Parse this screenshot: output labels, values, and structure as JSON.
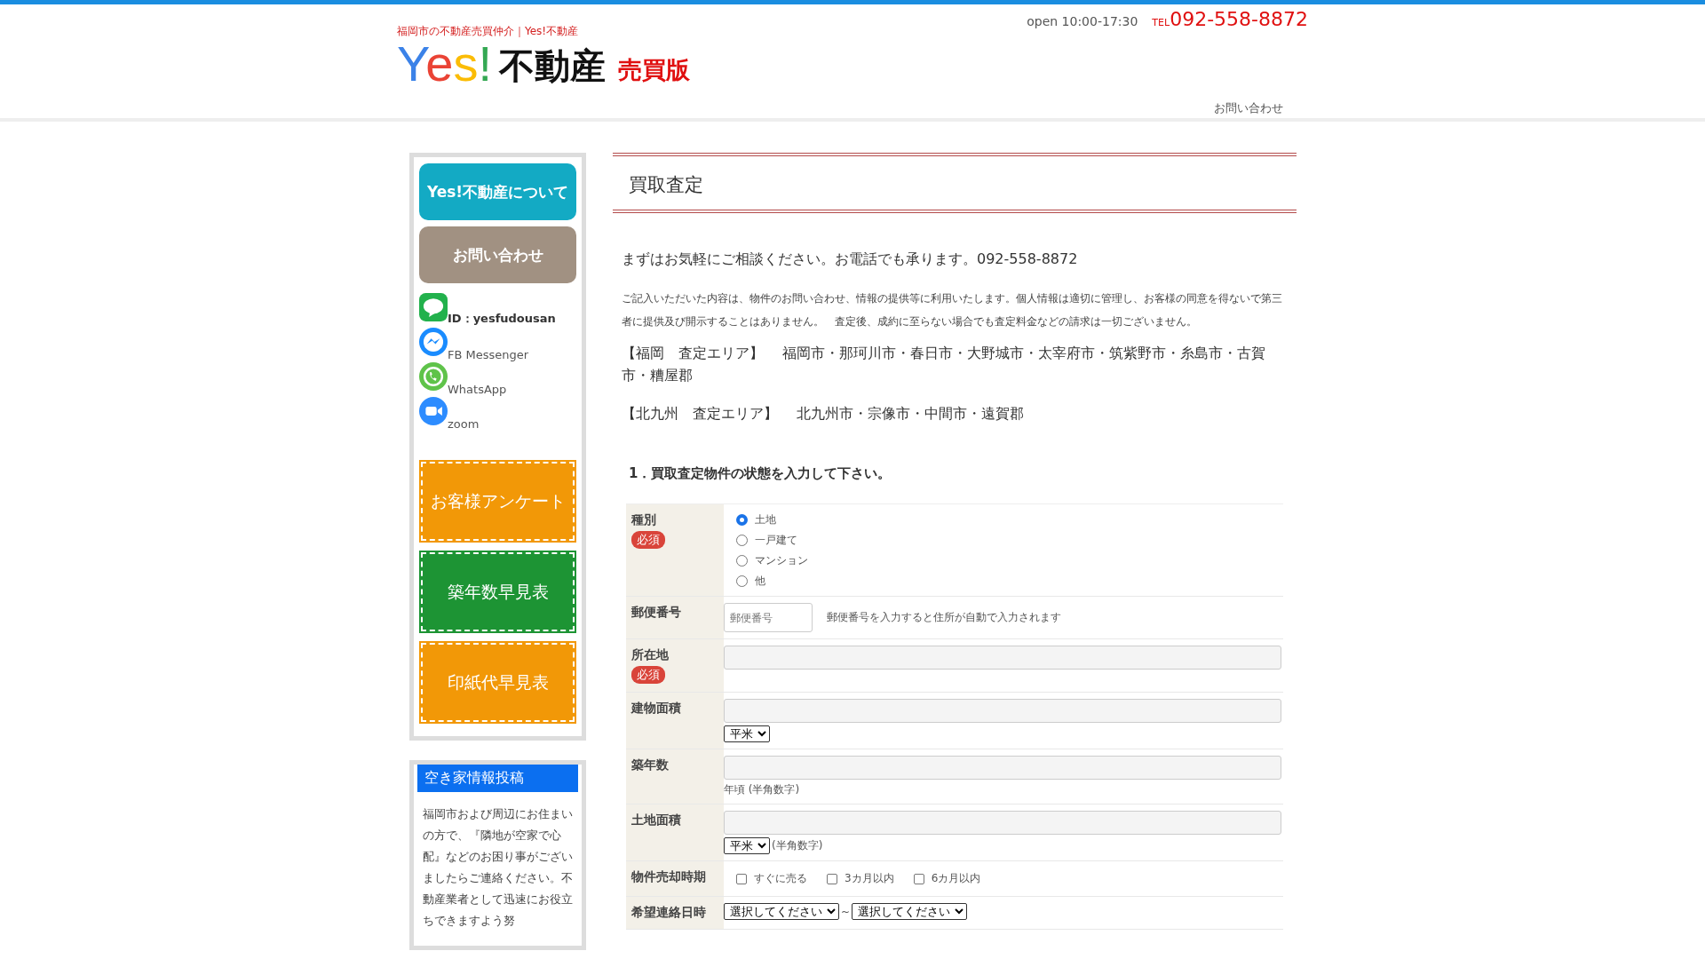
{
  "header": {
    "tagline": "福岡市の不動産売買仲介｜Yes!不動産",
    "logo": {
      "letters": [
        {
          "char": "Y",
          "color": "#3b82e8"
        },
        {
          "char": "e",
          "color": "#ea4335"
        },
        {
          "char": "s",
          "color": "#fbbc05"
        },
        {
          "char": "!",
          "color": "#34a853"
        }
      ],
      "name": "不動産",
      "edition": "売買版"
    },
    "hours": "open 10:00-17:30",
    "tel_prefix": "TEL",
    "tel": "092-558-8872",
    "nav": [
      "お問い合わせ"
    ]
  },
  "sidebar": {
    "banners": [
      {
        "label": "Yes!不動産について",
        "kind": "rounded",
        "color": "#13aac4"
      },
      {
        "label": "お問い合わせ",
        "kind": "rounded",
        "color": "#a19182"
      }
    ],
    "contacts": [
      {
        "kind": "line",
        "label": "ID：yesfudousan"
      },
      {
        "kind": "messenger",
        "label": "FB Messenger"
      },
      {
        "kind": "whatsapp",
        "label": "WhatsApp"
      },
      {
        "kind": "zoom",
        "label": "zoom"
      }
    ],
    "links": [
      {
        "label": "お客様アンケート",
        "kind": "stitched",
        "color": "#f29807"
      },
      {
        "label": "築年数早見表",
        "kind": "stitched",
        "color": "#1d9434"
      },
      {
        "label": "印紙代早見表",
        "kind": "stitched",
        "color": "#f29807"
      }
    ],
    "post_box": {
      "title": "空き家情報投稿",
      "text": "福岡市および周辺にお住まいの方で、『隣地が空家で心配』などのお困り事がございましたらご連絡ください。不動産業者として迅速にお役立ちできますよう努"
    }
  },
  "main": {
    "title": "買取査定",
    "lead": "まずはお気軽にご相談ください。お電話でも承ります。092-558-8872",
    "notice": "ご記入いただいた内容は、物件のお問い合わせ、情報の提供等に利用いたします。個人情報は適切に管理し、お客様の同意を得ないで第三者に提供及び開示することはありません。　査定後、成約に至らない場合でも査定料金などの請求は一切ございません。",
    "areas": [
      "【福岡　査定エリア】　 福岡市・那珂川市・春日市・大野城市・太宰府市・筑紫野市・糸島市・古賀市・糟屋郡",
      "【北九州　査定エリア】　 北九州市・宗像市・中間市・遠賀郡"
    ],
    "section_heading": "1．買取査定物件の状態を入力して下さい。",
    "form": [
      {
        "label": "種別",
        "badge": "必須",
        "kind": "radio",
        "options": [
          {
            "label": "土地",
            "selected": true
          },
          {
            "label": "一戸建て",
            "selected": false
          },
          {
            "label": "マンション",
            "selected": false
          },
          {
            "label": "他",
            "selected": false
          }
        ]
      },
      {
        "label": "郵便番号",
        "kind": "postal",
        "placeholder": "郵便番号",
        "hint": "郵便番号を入力すると住所が自動で入力されます"
      },
      {
        "label": "所在地",
        "badge": "必須",
        "kind": "text"
      },
      {
        "label": "建物面積",
        "kind": "text",
        "unit": "平米"
      },
      {
        "label": "築年数",
        "kind": "text",
        "note": "年頃 (半角数字)"
      },
      {
        "label": "土地面積",
        "kind": "text",
        "unit": "平米",
        "note": "(半角数字)"
      },
      {
        "label": "物件売却時期",
        "kind": "checkbox",
        "options": [
          {
            "label": "すぐに売る",
            "checked": false
          },
          {
            "label": "3カ月以内",
            "checked": false
          },
          {
            "label": "6カ月以内",
            "checked": false
          }
        ]
      },
      {
        "label": "希望連絡日時",
        "kind": "range",
        "selects": [
          "選択してください",
          "選択してください"
        ],
        "separator": "~"
      }
    ]
  }
}
